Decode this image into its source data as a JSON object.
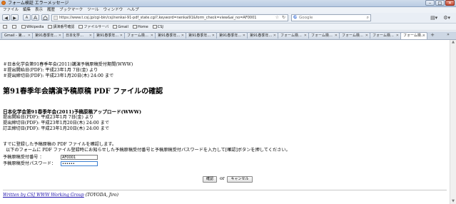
{
  "window": {
    "title": "フォーム検証 エラーメッセージ",
    "controls": [
      "–",
      "□",
      "✕"
    ]
  },
  "menu": [
    "ファイル",
    "編集",
    "表示",
    "履歴",
    "ブックマーク",
    "ツール",
    "ウィンドウ",
    "ヘルプ"
  ],
  "nav": {
    "back": "◀",
    "forward": "▶",
    "font_smaller": "A",
    "font_larger": "A",
    "url": "https://www.t.csj.jp/cgi-bin/csj/nenkai-91-pdf_state.cgi?,keyword=nenkai91&form_check=view&ai_no=AF0001",
    "search_placeholder": "Google",
    "search_engine_icon": "G",
    "right_tools": [
      "▤▾",
      "⚙▾"
    ]
  },
  "bookmarks": [
    "Wikipedia",
    "講演番号確認",
    "ファイルサーバ",
    "Gmail",
    "Home",
    "CSJ"
  ],
  "tabs": [
    "Gmail - 第…",
    "第91春季年…",
    "日本化学…",
    "第91春季年…",
    "フォーム検…",
    "第91春季年…",
    "第91春季年…",
    "第91春季年…",
    "第91春季年…",
    "フォーム検…",
    "フォーム検…",
    "フォーム検…",
    "フォーム検…",
    "フォーム検…"
  ],
  "active_tab_index": 13,
  "page": {
    "info_lines": [
      "＃日本化学会第91春季年会(2011)講演予稿原稿受付期間(WWW)",
      "＃提出開始日(PDF): 平成23年1月 7日(金) より",
      "＃提出締切日(PDF): 平成23年1月20日(木) 24:00 まで"
    ],
    "heading": "第91春季年会講演予稿原稿 PDF ファイルの確認",
    "subheading": "日本化学会第91春季年会(2011)予稿原稿アップロード(WWW)",
    "schedule_lines": [
      "提出開始日(PDF): 平成23年1月 7日(金) より",
      "提出締切日(PDF): 平成23年1月20日(木) 24:00 まで",
      "訂正締切日(PDF): 平成23年1月20日(木) 24:00 まで"
    ],
    "instructions": [
      "すでに登録した予稿原稿の PDF ファイルを確認します。",
      "以下のフォームに PDF ファイル登録時にお知らせした予稿原稿受付番号と予稿原稿受付パスワードを入力して[確認]ボタンを押してください。"
    ],
    "form": {
      "number_label": "予稿原稿受付番号 ：",
      "number_value": "AF0001",
      "password_label": "予稿原稿受付パスワード：",
      "password_value": "••••••",
      "confirm_label": "確認",
      "or_text": "or",
      "cancel_label": "キャンセル"
    },
    "footer": {
      "link_text": "Written by CSJ WWW Working Group",
      "author": " (TOYODA, Jiro)"
    }
  }
}
